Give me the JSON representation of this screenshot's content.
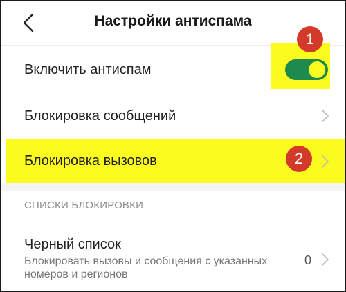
{
  "header": {
    "title": "Настройки антиспама",
    "back_icon": "chevron-left-icon"
  },
  "settings": {
    "enable_label": "Включить антиспам",
    "enable_on": true,
    "messages_label": "Блокировка сообщений",
    "calls_label": "Блокировка вызовов"
  },
  "blocklists": {
    "section_label": "СПИСКИ БЛОКИРОВКИ",
    "blacklist_title": "Черный список",
    "blacklist_desc": "Блокировать вызовы и сообщения с указанных номеров и регионов",
    "blacklist_count": "0"
  },
  "annotations": {
    "badge1": "1",
    "badge2": "2"
  },
  "colors": {
    "toggle_track": "#1f8a4d",
    "toggle_knob": "#fbfb1f",
    "highlight": "#fbfb1f",
    "badge": "#d43a2a"
  }
}
